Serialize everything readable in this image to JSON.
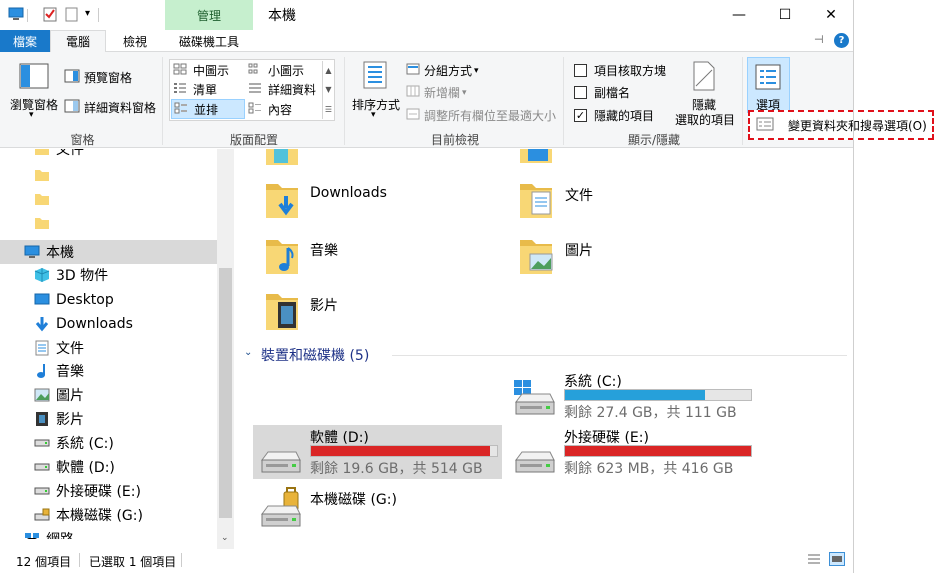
{
  "window": {
    "title": "本機",
    "context_tab_header": "管理",
    "controls": {
      "minimize": "—",
      "maximize": "☐",
      "close": "✕"
    }
  },
  "tabs": {
    "file": "檔案",
    "computer": "電腦",
    "view": "檢視",
    "drive_tools": "磁碟機工具"
  },
  "ribbon": {
    "panes": {
      "label": "窗格",
      "nav_pane": "瀏覽窗格",
      "preview_pane": "預覽窗格",
      "details_pane": "詳細資料窗格"
    },
    "layout": {
      "label": "版面配置",
      "medium_icons": "中圖示",
      "small_icons": "小圖示",
      "list": "清單",
      "details": "詳細資料",
      "tiles": "並排",
      "content": "內容"
    },
    "current_view": {
      "label": "目前檢視",
      "sort_by": "排序方式",
      "group_by": "分組方式",
      "add_columns": "新增欄",
      "size_columns": "調整所有欄位至最適大小"
    },
    "show_hide": {
      "label": "顯示/隱藏",
      "item_checkboxes": "項目核取方塊",
      "file_extensions": "副檔名",
      "hidden_items": "隱藏的項目",
      "hide_selected_1": "隱藏",
      "hide_selected_2": "選取的項目",
      "item_checkboxes_checked": false,
      "file_extensions_checked": false,
      "hidden_items_checked": true
    },
    "options": {
      "label": "選項"
    }
  },
  "dropdown": {
    "change_options": "變更資料夾和搜尋選項(O)"
  },
  "sidebar": {
    "items": [
      {
        "label": "文件",
        "icon": "folder-icon"
      },
      {
        "label": "",
        "icon": "folder-icon"
      },
      {
        "label": "",
        "icon": "folder-icon"
      },
      {
        "label": "",
        "icon": "folder-icon"
      },
      {
        "label": "本機",
        "icon": "computer-icon"
      },
      {
        "label": "3D 物件",
        "icon": "3d-objects-icon"
      },
      {
        "label": "Desktop",
        "icon": "desktop-icon"
      },
      {
        "label": "Downloads",
        "icon": "downloads-icon"
      },
      {
        "label": "文件",
        "icon": "documents-icon"
      },
      {
        "label": "音樂",
        "icon": "music-icon"
      },
      {
        "label": "圖片",
        "icon": "pictures-icon"
      },
      {
        "label": "影片",
        "icon": "videos-icon"
      },
      {
        "label": "系統 (C:)",
        "icon": "drive-icon"
      },
      {
        "label": "軟體 (D:)",
        "icon": "drive-icon"
      },
      {
        "label": "外接硬碟 (E:)",
        "icon": "drive-icon"
      },
      {
        "label": "本機磁碟 (G:)",
        "icon": "locked-drive-icon"
      },
      {
        "label": "網路",
        "icon": "network-icon"
      }
    ]
  },
  "content": {
    "folders": [
      {
        "label": "Downloads",
        "icon": "downloads-folder-icon"
      },
      {
        "label": "文件",
        "icon": "documents-folder-icon"
      },
      {
        "label": "音樂",
        "icon": "music-folder-icon"
      },
      {
        "label": "圖片",
        "icon": "pictures-folder-icon"
      },
      {
        "label": "影片",
        "icon": "videos-folder-icon"
      }
    ],
    "devices_header": "裝置和磁碟機 (5)",
    "drives": [
      {
        "name": "系統 (C:)",
        "free": "剩餘 27.4 GB，共 111 GB",
        "used": 0.753,
        "color": "#26a0da"
      },
      {
        "name": "軟體 (D:)",
        "free": "剩餘 19.6 GB，共 514 GB",
        "used": 0.962,
        "color": "#da2626"
      },
      {
        "name": "外接硬碟 (E:)",
        "free": "剩餘 623 MB，共 416 GB",
        "used": 0.998,
        "color": "#da2626"
      },
      {
        "name": "本機磁碟 (G:)",
        "free": "",
        "used": 0,
        "color": "#26a0da"
      }
    ]
  },
  "status": {
    "item_count": "12 個項目",
    "selected": "已選取 1 個項目"
  }
}
